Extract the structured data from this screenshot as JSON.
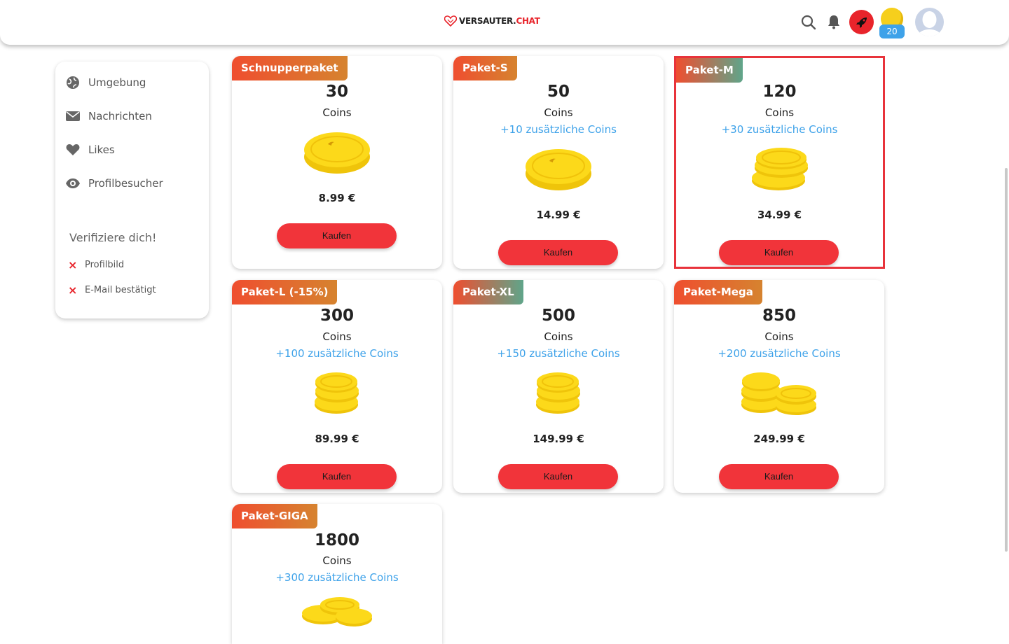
{
  "header": {
    "logo_part1": "VERSAUTER.",
    "logo_part2": "CHAT",
    "coin_balance": "20",
    "colors": {
      "accent": "#e8242b",
      "badge": "#3ea2e9"
    }
  },
  "sidebar": {
    "items": [
      {
        "label": "Umgebung",
        "icon": "globe-icon"
      },
      {
        "label": "Nachrichten",
        "icon": "envelope-icon"
      },
      {
        "label": "Likes",
        "icon": "heart-icon"
      },
      {
        "label": "Profilbesucher",
        "icon": "eye-icon"
      }
    ],
    "verify_title": "Verifiziere dich!",
    "verify_items": [
      {
        "label": "Profilbild",
        "status": "×"
      },
      {
        "label": "E-Mail bestätigt",
        "status": "×"
      }
    ]
  },
  "packages": [
    {
      "name": "Schnupperpaket",
      "amount": "30",
      "unit": "Coins",
      "bonus": "",
      "price": "8.99 €",
      "button": "Kaufen",
      "selected": false
    },
    {
      "name": "Paket-S",
      "amount": "50",
      "unit": "Coins",
      "bonus": "+10 zusätzliche Coins",
      "price": "14.99 €",
      "button": "Kaufen",
      "selected": false
    },
    {
      "name": "Paket-M",
      "amount": "120",
      "unit": "Coins",
      "bonus": "+30 zusätzliche Coins",
      "price": "34.99 €",
      "button": "Kaufen",
      "selected": true
    },
    {
      "name": "Paket-L (-15%)",
      "amount": "300",
      "unit": "Coins",
      "bonus": "+100 zusätzliche Coins",
      "price": "89.99 €",
      "button": "Kaufen",
      "selected": false
    },
    {
      "name": "Paket-XL",
      "amount": "500",
      "unit": "Coins",
      "bonus": "+150 zusätzliche Coins",
      "price": "149.99 €",
      "button": "Kaufen",
      "selected": false
    },
    {
      "name": "Paket-Mega",
      "amount": "850",
      "unit": "Coins",
      "bonus": "+200 zusätzliche Coins",
      "price": "249.99 €",
      "button": "Kaufen",
      "selected": false
    },
    {
      "name": "Paket-GIGA",
      "amount": "1800",
      "unit": "Coins",
      "bonus": "+300 zusätzliche Coins",
      "price": "",
      "button": "",
      "selected": false
    }
  ]
}
